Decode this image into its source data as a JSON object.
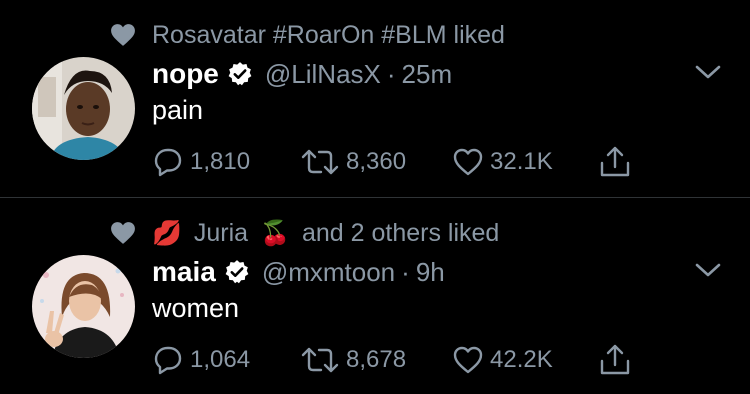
{
  "colors": {
    "background": "#000000",
    "text": "#ffffff",
    "muted": "#8b98a5",
    "divider": "#2f3336"
  },
  "tweets": [
    {
      "context": {
        "icon": "heart-icon",
        "text": "Rosavatar #RoarOn #BLM liked"
      },
      "author": {
        "name": "nope",
        "verified": true,
        "handle": "@LilNasX",
        "time": "25m"
      },
      "text": "pain",
      "stats": {
        "replies": "1,810",
        "retweets": "8,360",
        "likes": "32.1K"
      }
    },
    {
      "context": {
        "icon": "heart-icon",
        "emoji1": "💋",
        "name": "Juria",
        "emoji2": "🍒",
        "text": "and 2 others liked"
      },
      "author": {
        "name": "maia",
        "verified": true,
        "handle": "@mxmtoon",
        "time": "9h"
      },
      "text": "women",
      "stats": {
        "replies": "1,064",
        "retweets": "8,678",
        "likes": "42.2K"
      }
    }
  ]
}
